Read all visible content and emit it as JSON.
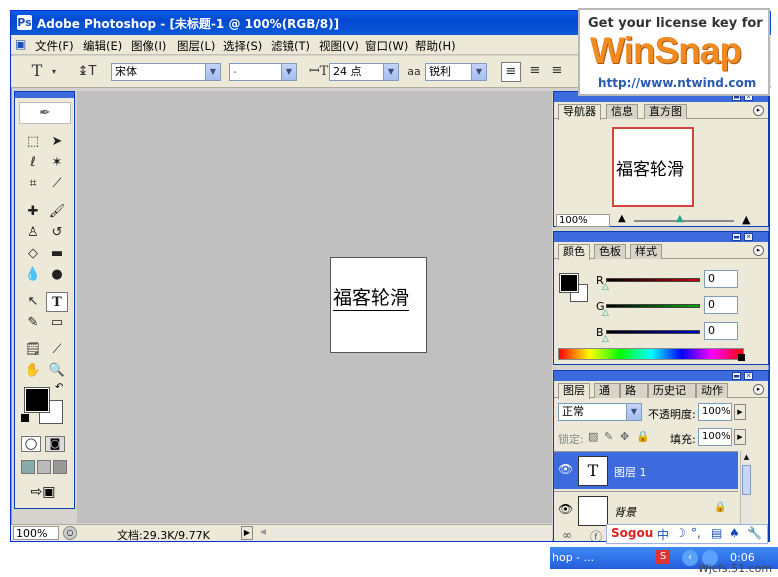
{
  "window": {
    "title": "Adobe Photoshop - [未标题-1 @ 100%(RGB/8)]",
    "app_icon": "photoshop-icon"
  },
  "menu": [
    "文件(F)",
    "编辑(E)",
    "图像(I)",
    "图层(L)",
    "选择(S)",
    "滤镜(T)",
    "视图(V)",
    "窗口(W)",
    "帮助(H)"
  ],
  "options": {
    "font_family": "宋体",
    "font_style": "-",
    "font_size": "24 点",
    "aa_label": "a",
    "aa_method": "锐利"
  },
  "document": {
    "text": "福客轮滑"
  },
  "status": {
    "zoom": "100%",
    "doc_info": "文档:29.3K/9.77K"
  },
  "navigator": {
    "tabs": [
      "导航器",
      "信息",
      "直方图"
    ],
    "preview_text": "福客轮滑",
    "zoom": "100%"
  },
  "color_panel": {
    "tabs": [
      "颜色",
      "色板",
      "样式"
    ],
    "channels": [
      {
        "label": "R",
        "value": "0",
        "color": "#cc0000"
      },
      {
        "label": "G",
        "value": "0",
        "color": "#00aa00"
      },
      {
        "label": "B",
        "value": "0",
        "color": "#0000cc"
      }
    ]
  },
  "layers_panel": {
    "tabs": [
      "图层",
      "通道",
      "路径",
      "历史记录",
      "动作"
    ],
    "blend_mode": "正常",
    "opacity_label": "不透明度:",
    "opacity": "100%",
    "lock_label": "锁定:",
    "fill_label": "填充:",
    "fill": "100%",
    "layers": [
      {
        "name": "图层 1",
        "thumb": "T",
        "selected": true
      },
      {
        "name": "背景",
        "thumb": "",
        "selected": false
      }
    ]
  },
  "watermark": {
    "heading": "Get your license key for",
    "brand": "WinSnap",
    "url": "http://www.ntwind.com"
  },
  "ime": {
    "brand": "Sogou",
    "mode": "中"
  },
  "taskbar": {
    "item": "hop - ...",
    "clock": "0:06"
  },
  "footer": "Wjcfs.51.com"
}
